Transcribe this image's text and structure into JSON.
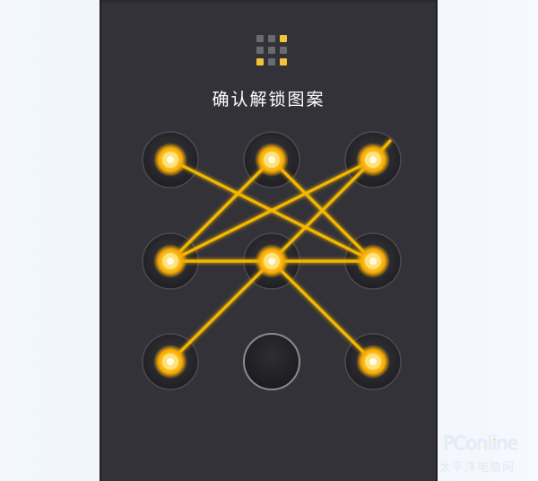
{
  "screen": {
    "title": "确认解锁图案"
  },
  "mini_indicator": {
    "icon": "pattern-preview-icon",
    "cells": [
      {
        "active": false
      },
      {
        "active": false
      },
      {
        "active": true
      },
      {
        "active": false
      },
      {
        "active": false
      },
      {
        "active": false
      },
      {
        "active": true
      },
      {
        "active": false
      },
      {
        "active": true
      }
    ]
  },
  "pattern_grid": {
    "nodes": [
      {
        "label": "1",
        "active": true
      },
      {
        "label": "2",
        "active": true
      },
      {
        "label": "3",
        "active": true
      },
      {
        "label": "4",
        "active": true
      },
      {
        "label": "5",
        "active": true
      },
      {
        "label": "6",
        "active": true
      },
      {
        "label": "7",
        "active": true
      },
      {
        "label": "8",
        "active": false
      },
      {
        "label": "9",
        "active": true
      }
    ],
    "connections": [
      [
        1,
        6
      ],
      [
        6,
        4
      ],
      [
        4,
        3
      ],
      [
        3,
        5
      ],
      [
        5,
        7
      ],
      [
        5,
        9
      ],
      [
        2,
        4
      ],
      [
        2,
        6
      ],
      [
        3,
        3
      ]
    ]
  },
  "colors": {
    "background": "#333238",
    "accent": "#f5b800",
    "glow": "#ffd34d",
    "inactive_node": "#2a2a2f",
    "text": "#ffffff"
  },
  "watermark": {
    "brand": "PConline",
    "sub": "太平洋电脑网"
  }
}
